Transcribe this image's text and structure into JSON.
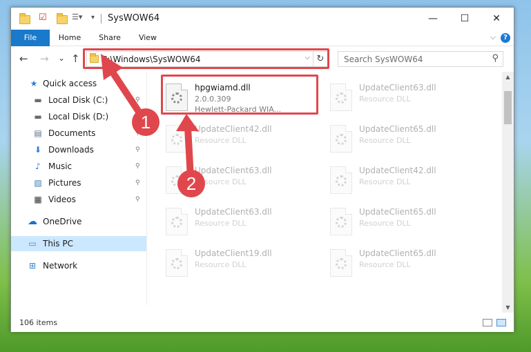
{
  "window": {
    "title": "SysWOW64",
    "controls": {
      "minimize": "—",
      "maximize": "☐",
      "close": "✕"
    }
  },
  "ribbon": {
    "tabs": [
      "File",
      "Home",
      "Share",
      "View"
    ],
    "help": "?",
    "expand": "⌵"
  },
  "address": {
    "path": "C:\\Windows\\SysWOW64",
    "dropdown": "⌵",
    "refresh": "↻"
  },
  "nav_buttons": {
    "back": "←",
    "forward": "→",
    "recent": "⌄",
    "up": "↑"
  },
  "search": {
    "placeholder": "Search SysWOW64",
    "icon": "⚲"
  },
  "nav_pane": {
    "items": [
      {
        "label": "Quick access",
        "icon": "★",
        "icon_color": "#2f7fd6",
        "pinned": false
      },
      {
        "label": "Local Disk (C:)",
        "icon": "▬",
        "icon_color": "#6b6b6b",
        "pinned": true
      },
      {
        "label": "Local Disk (D:)",
        "icon": "▬",
        "icon_color": "#6b6b6b",
        "pinned": true
      },
      {
        "label": "Documents",
        "icon": "▤",
        "icon_color": "#5c6f86",
        "pinned": true
      },
      {
        "label": "Downloads",
        "icon": "⬇",
        "icon_color": "#2f7fd6",
        "pinned": true
      },
      {
        "label": "Music",
        "icon": "♪",
        "icon_color": "#2f7fd6",
        "pinned": true
      },
      {
        "label": "Pictures",
        "icon": "▧",
        "icon_color": "#3a7fb0",
        "pinned": true
      },
      {
        "label": "Videos",
        "icon": "▦",
        "icon_color": "#333333",
        "pinned": true
      },
      {
        "label": "OneDrive",
        "icon": "☁",
        "icon_color": "#1a6fd0",
        "pinned": false
      },
      {
        "label": "This PC",
        "icon": "▭",
        "icon_color": "#2f8ad6",
        "pinned": false
      },
      {
        "label": "Network",
        "icon": "⊞",
        "icon_color": "#2f7fd6",
        "pinned": false
      }
    ],
    "pin_glyph": "📌"
  },
  "files": [
    {
      "name": "hpgwiamd.dll",
      "line2": "2.0.0.309",
      "line3": "Hewlett-Packard WIA..."
    },
    {
      "name": "UpdateClient63.dll",
      "line2": "Resource DLL"
    },
    {
      "name": "UpdateClient42.dll",
      "line2": "Resource DLL"
    },
    {
      "name": "UpdateClient65.dll",
      "line2": "Resource DLL"
    },
    {
      "name": "UpdateClient63.dll",
      "line2": "Resource DLL"
    },
    {
      "name": "UpdateClient42.dll",
      "line2": "Resource DLL"
    },
    {
      "name": "UpdateClient63.dll",
      "line2": "Resource DLL"
    },
    {
      "name": "UpdateClient65.dll",
      "line2": "Resource DLL"
    },
    {
      "name": "UpdateClient19.dll",
      "line2": "Resource DLL"
    },
    {
      "name": "UpdateClient65.dll",
      "line2": "Resource DLL"
    }
  ],
  "status": {
    "items_count": "106 items"
  },
  "callouts": [
    "1",
    "2"
  ],
  "colors": {
    "accent": "#1979ca",
    "annotation": "#e0474c",
    "selection": "#cce8ff"
  }
}
